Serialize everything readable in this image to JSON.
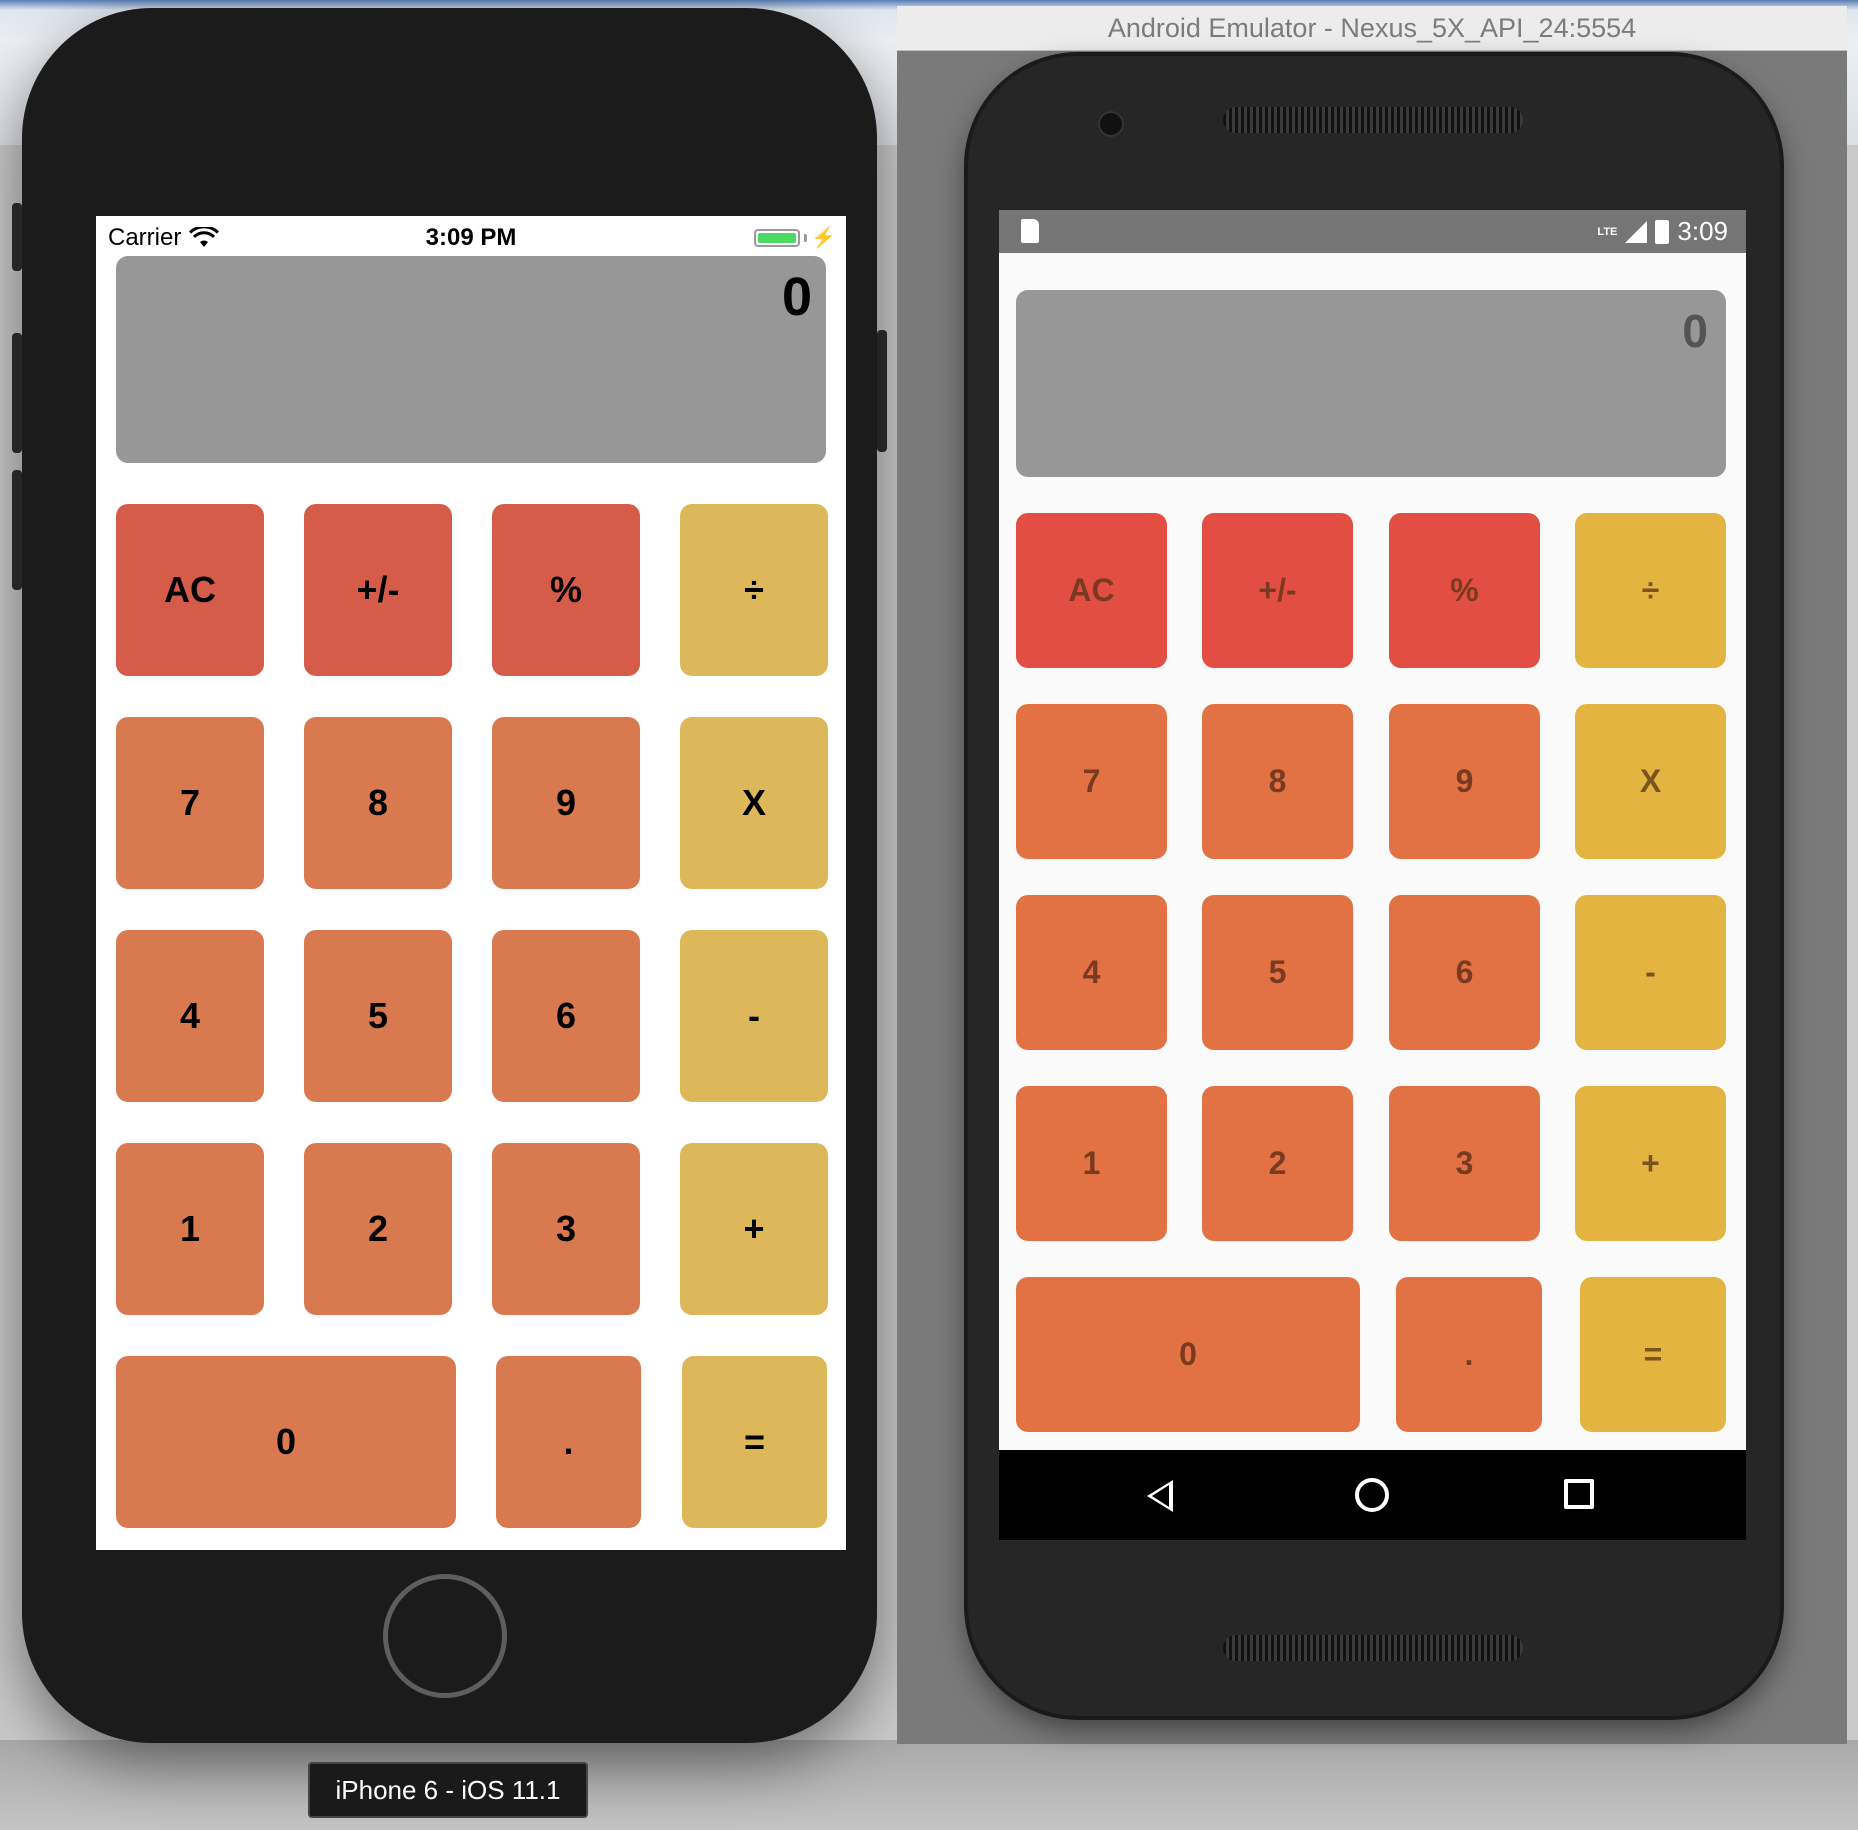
{
  "desktop": {
    "iphone_label": "iPhone 6 - iOS 11.1",
    "emulator_title": "Android Emulator - Nexus_5X_API_24:5554"
  },
  "ios": {
    "status": {
      "carrier": "Carrier",
      "time": "3:09 PM",
      "charging": "⚡"
    },
    "display": {
      "value": "0"
    },
    "keys": {
      "ac": "AC",
      "sign": "+/-",
      "percent": "%",
      "divide": "÷",
      "seven": "7",
      "eight": "8",
      "nine": "9",
      "multiply": "X",
      "four": "4",
      "five": "5",
      "six": "6",
      "minus": "-",
      "one": "1",
      "two": "2",
      "three": "3",
      "plus": "+",
      "zero": "0",
      "decimal": ".",
      "equals": "="
    },
    "colors": {
      "function": "#d65c4a",
      "digit": "#d97950",
      "operator": "#ddb85a",
      "display": "#979797"
    }
  },
  "android": {
    "status": {
      "network": "LTE",
      "time": "3:09"
    },
    "display": {
      "value": "0"
    },
    "keys": {
      "ac": "AC",
      "sign": "+/-",
      "percent": "%",
      "divide": "÷",
      "seven": "7",
      "eight": "8",
      "nine": "9",
      "multiply": "X",
      "four": "4",
      "five": "5",
      "six": "6",
      "minus": "-",
      "one": "1",
      "two": "2",
      "three": "3",
      "plus": "+",
      "zero": "0",
      "decimal": ".",
      "equals": "="
    },
    "nav": {
      "back_icon": "back-triangle",
      "home_icon": "home-circle",
      "recents_icon": "recents-square"
    },
    "colors": {
      "function": "#e24f42",
      "digit": "#e27244",
      "operator": "#e3b440",
      "display": "#979797"
    }
  }
}
